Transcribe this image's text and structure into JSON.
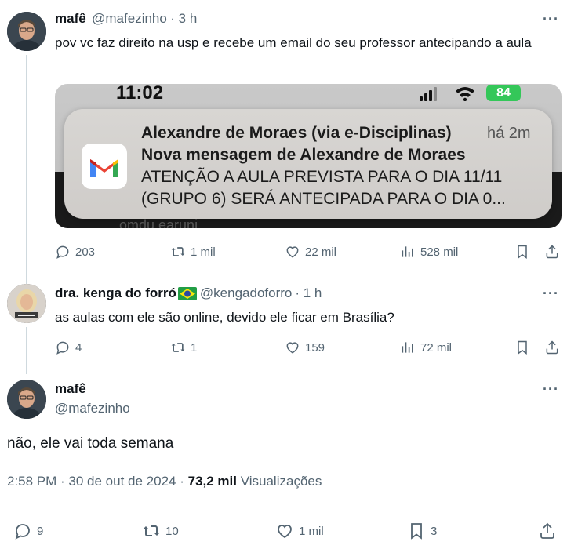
{
  "tweets": [
    {
      "display_name": "mafê",
      "handle": "@mafezinho",
      "time": "· 3 h",
      "text": "pov vc faz direito na usp e recebe um email do seu professor antecipando a aula",
      "stats": {
        "replies": "203",
        "retweets": "1 mil",
        "likes": "22 mil",
        "views": "528 mil"
      }
    },
    {
      "display_name": "dra. kenga do forró",
      "handle": "@kengadoforro",
      "time": "· 1 h",
      "text": "as aulas com ele são online, devido ele ficar em Brasília?",
      "stats": {
        "replies": "4",
        "retweets": "1",
        "likes": "159",
        "views": "72 mil"
      }
    }
  ],
  "main_tweet": {
    "display_name": "mafê",
    "handle": "@mafezinho",
    "text": "não, ele vai toda semana",
    "timestamp": "2:58 PM · 30 de out de 2024 ·",
    "views_count": "73,2 mil",
    "views_label": "Visualizações",
    "stats": {
      "replies": "9",
      "retweets": "10",
      "likes": "1 mil",
      "bookmarks": "3"
    }
  },
  "notification": {
    "clock": "11:02",
    "battery": "84",
    "sender": "Alexandre de Moraes (via e-Disciplinas)",
    "age": "há 2m",
    "subject": "Nova mensagem de Alexandre de Moraes",
    "line1": "ATENÇÃO A AULA PREVISTA PARA O DIA 11/11",
    "line2": "(GRUPO 6) SERÁ ANTECIPADA PARA O DIA 0...",
    "behind_text": "omdu earuni"
  },
  "more_label": "···",
  "colors": {
    "text": "#0f1419",
    "muted": "#536471",
    "line": "#cfd9de",
    "battery": "#34c759"
  },
  "icons": [
    "reply-icon",
    "retweet-icon",
    "like-icon",
    "views-icon",
    "bookmark-icon",
    "share-icon",
    "more-icon",
    "gmail-icon",
    "signal-icon",
    "wifi-icon",
    "battery-icon",
    "brazil-flag-icon"
  ]
}
